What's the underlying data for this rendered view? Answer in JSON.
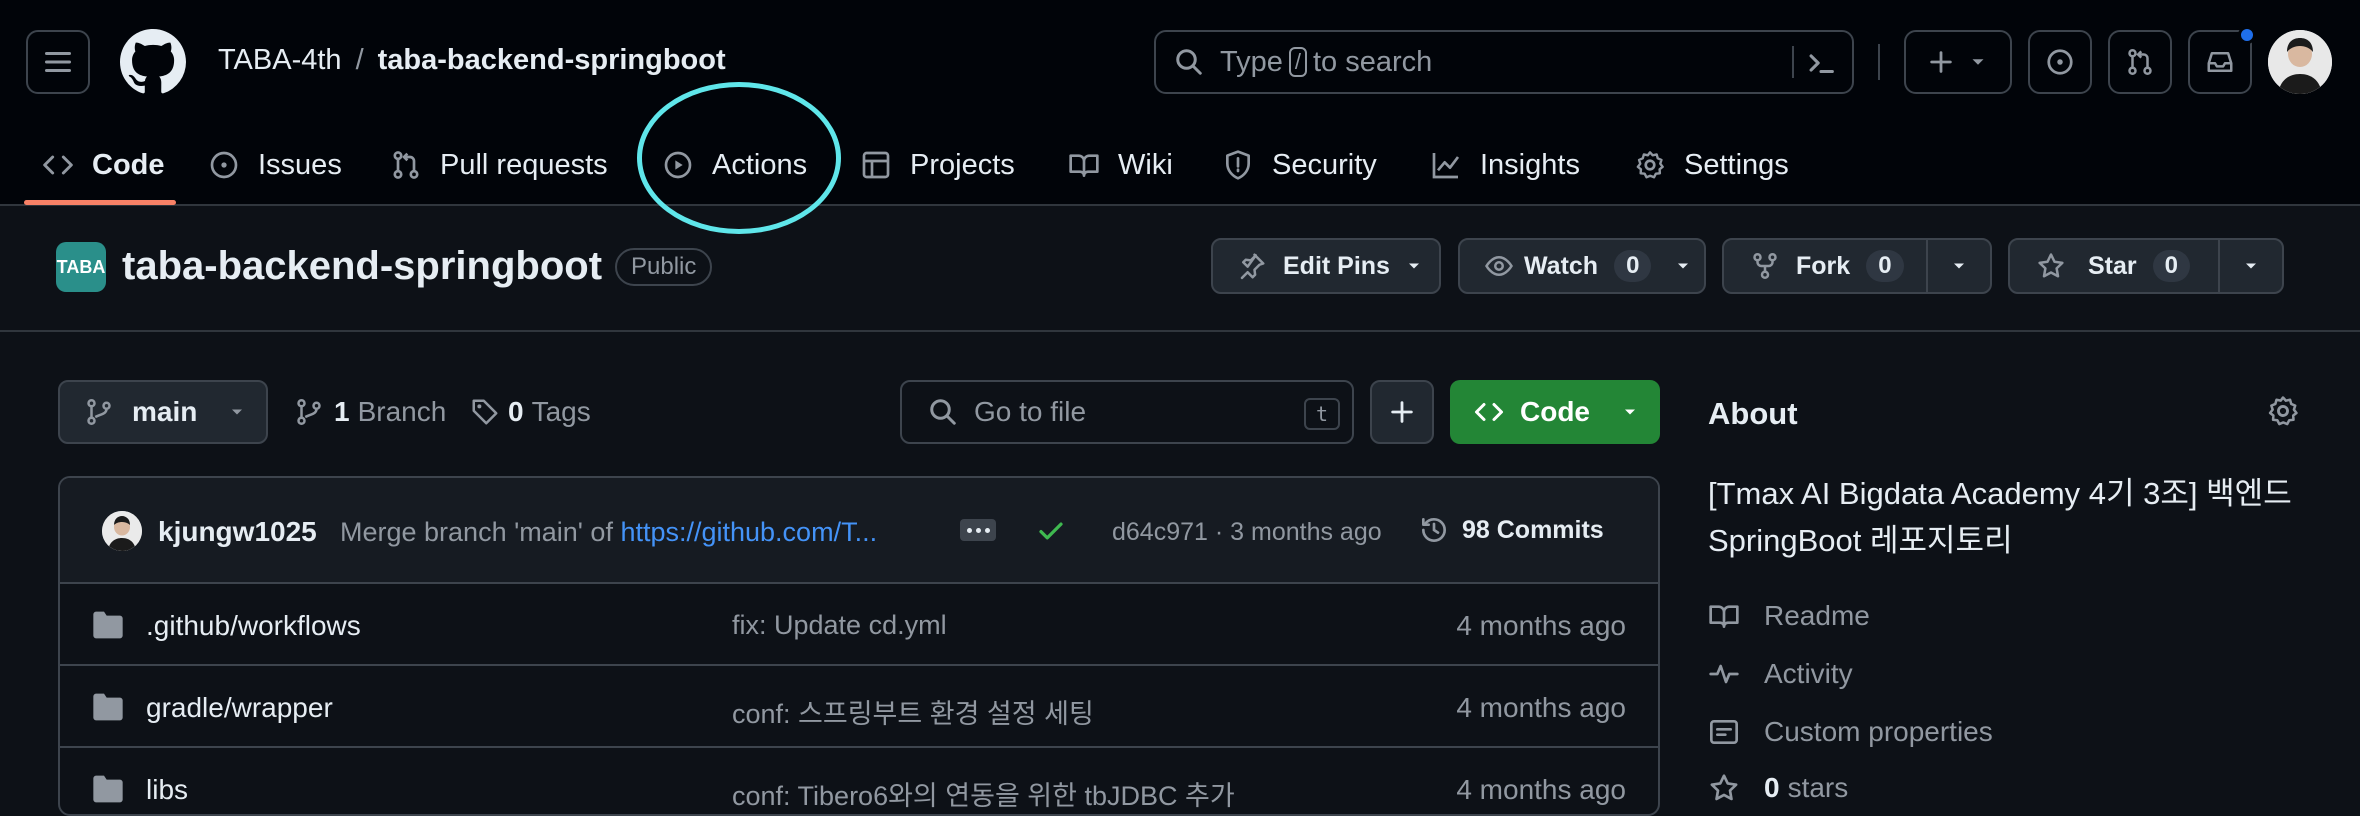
{
  "breadcrumb": {
    "owner": "TABA-4th",
    "separator": "/",
    "repo": "taba-backend-springboot"
  },
  "search": {
    "prefix": "Type",
    "key": "/",
    "suffix": "to search"
  },
  "tabs": [
    {
      "label": "Code",
      "icon": "code-icon",
      "active": true
    },
    {
      "label": "Issues",
      "icon": "issue-icon"
    },
    {
      "label": "Pull requests",
      "icon": "pull-request-icon"
    },
    {
      "label": "Actions",
      "icon": "play-icon"
    },
    {
      "label": "Projects",
      "icon": "table-icon"
    },
    {
      "label": "Wiki",
      "icon": "book-icon"
    },
    {
      "label": "Security",
      "icon": "shield-icon"
    },
    {
      "label": "Insights",
      "icon": "graph-icon"
    },
    {
      "label": "Settings",
      "icon": "gear-icon"
    }
  ],
  "repo": {
    "logo_text": "TABA",
    "name": "taba-backend-springboot",
    "visibility": "Public",
    "edit_pins": "Edit Pins",
    "watch": {
      "label": "Watch",
      "count": "0"
    },
    "fork": {
      "label": "Fork",
      "count": "0"
    },
    "star": {
      "label": "Star",
      "count": "0"
    }
  },
  "browser": {
    "branch": "main",
    "branches_count": "1",
    "branches_label": "Branch",
    "tags_count": "0",
    "tags_label": "Tags",
    "goto_placeholder": "Go to file",
    "goto_key": "t",
    "code_label": "Code"
  },
  "commit": {
    "author": "kjungw1025",
    "message_prefix": "Merge branch 'main' of ",
    "message_link": "https://github.com/T...",
    "hash_time": "d64c971 · 3 months ago",
    "commits_count": "98 Commits"
  },
  "files": [
    {
      "name": ".github/workflows",
      "message": "fix: Update cd.yml",
      "time": "4 months ago"
    },
    {
      "name": "gradle/wrapper",
      "message": "conf: 스프링부트 환경 설정 세팅",
      "time": "4 months ago"
    },
    {
      "name": "libs",
      "message": "conf: Tibero6와의 연동을 위한 tbJDBC 추가",
      "time": "4 months ago"
    }
  ],
  "about": {
    "title": "About",
    "description": "[Tmax AI Bigdata Academy 4기 3조] 백엔드 SpringBoot 레포지토리",
    "readme": "Readme",
    "activity": "Activity",
    "custom_properties": "Custom properties",
    "stars_count": "0",
    "stars_label": "stars"
  },
  "colors": {
    "background": "#0d1117",
    "header": "#010409",
    "accent_underline": "#f78166",
    "primary_button": "#238636",
    "link": "#4493f8",
    "highlight_ring": "#5fe6ea"
  }
}
